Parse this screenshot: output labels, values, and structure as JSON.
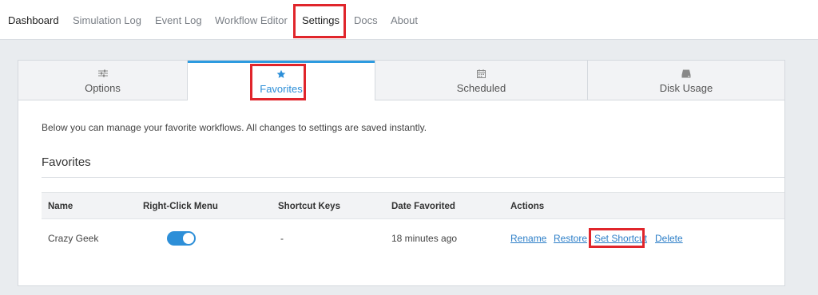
{
  "nav": {
    "items": [
      "Dashboard",
      "Simulation Log",
      "Event Log",
      "Workflow Editor",
      "Settings",
      "Docs",
      "About"
    ]
  },
  "tabs": [
    {
      "label": "Options",
      "icon": "sliders-icon"
    },
    {
      "label": "Favorites",
      "icon": "star-icon"
    },
    {
      "label": "Scheduled",
      "icon": "calendar-icon"
    },
    {
      "label": "Disk Usage",
      "icon": "disk-icon"
    }
  ],
  "active_tab": "Favorites",
  "description": "Below you can manage your favorite workflows. All changes to settings are saved instantly.",
  "section_title": "Favorites",
  "table": {
    "headers": [
      "Name",
      "Right-Click Menu",
      "Shortcut Keys",
      "Date Favorited",
      "Actions"
    ],
    "rows": [
      {
        "name": "Crazy Geek",
        "right_click_enabled": true,
        "shortcut_keys": "-",
        "date_favorited": "18 minutes ago",
        "actions": [
          "Rename",
          "Restore",
          "Set Shortcut",
          "Delete"
        ]
      }
    ]
  },
  "colors": {
    "accent": "#2d8fd8",
    "highlight": "#e0252b",
    "link": "#2d7fc8"
  }
}
